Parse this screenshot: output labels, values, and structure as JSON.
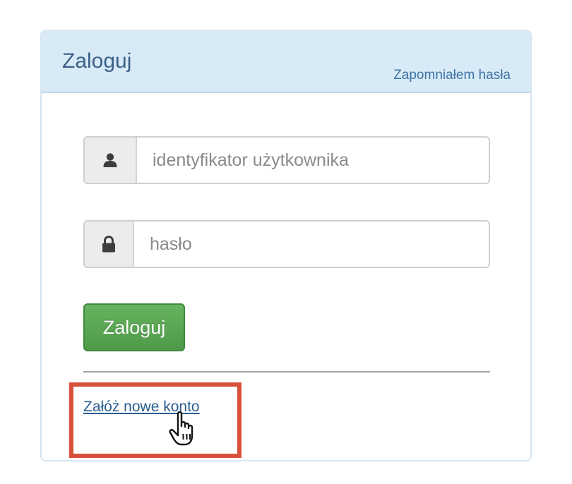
{
  "panel": {
    "title": "Zaloguj",
    "forgot_password_link": "Zapomniałem hasła"
  },
  "form": {
    "username": {
      "placeholder": "identyfikator użytkownika",
      "value": "",
      "icon": "user-icon"
    },
    "password": {
      "placeholder": "hasło",
      "value": "",
      "icon": "lock-icon"
    },
    "submit_label": "Zaloguj"
  },
  "footer": {
    "create_account_link": "Załóż nowe konto"
  },
  "annotation": {
    "highlight_color": "#d85039",
    "cursor": "hand-pointer-cursor"
  },
  "colors": {
    "heading_bg": "#d8eaf6",
    "title_text": "#3b6088",
    "link": "#3d72a6",
    "button_green": "#5cb85c"
  }
}
